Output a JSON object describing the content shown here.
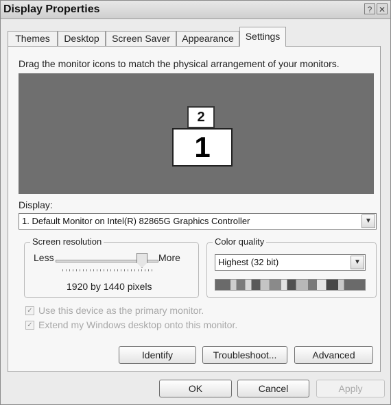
{
  "window": {
    "title": "Display Properties",
    "help_glyph": "?",
    "close_glyph": "✕"
  },
  "tabs": [
    {
      "label": "Themes"
    },
    {
      "label": "Desktop"
    },
    {
      "label": "Screen Saver"
    },
    {
      "label": "Appearance"
    },
    {
      "label": "Settings",
      "active": true
    }
  ],
  "settings": {
    "instruction": "Drag the monitor icons to match the physical arrangement of your monitors.",
    "monitors": {
      "secondary": "2",
      "primary": "1"
    },
    "display_label": "Display:",
    "display_value": "1. Default Monitor on Intel(R) 82865G Graphics Controller",
    "screen_resolution": {
      "legend": "Screen resolution",
      "less_label": "Less",
      "more_label": "More",
      "value_text": "1920 by 1440 pixels",
      "slider_level": 0.85
    },
    "color_quality": {
      "legend": "Color quality",
      "value": "Highest (32 bit)"
    },
    "checkboxes": [
      {
        "label": "Use this device as the primary monitor.",
        "checked": true,
        "enabled": false
      },
      {
        "label": "Extend my Windows desktop onto this monitor.",
        "checked": true,
        "enabled": false
      }
    ],
    "buttons": {
      "identify": "Identify",
      "troubleshoot": "Troubleshoot...",
      "advanced": "Advanced"
    }
  },
  "footer": {
    "ok": "OK",
    "cancel": "Cancel",
    "apply": "Apply"
  }
}
